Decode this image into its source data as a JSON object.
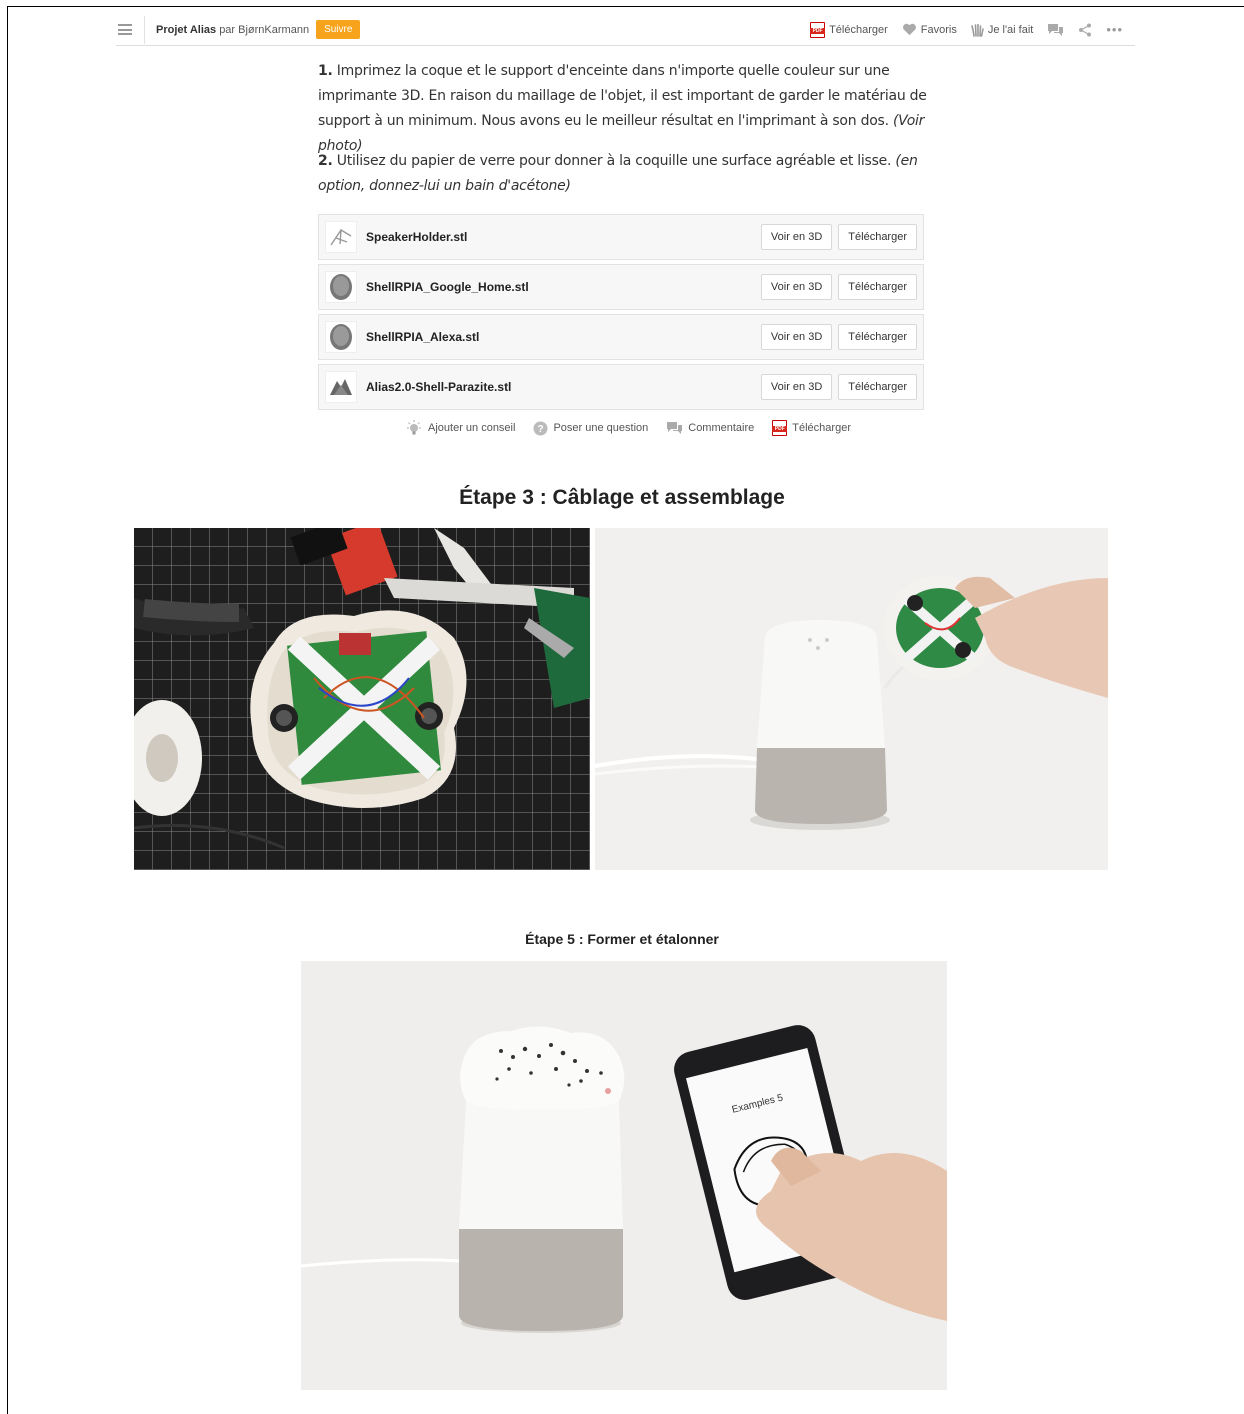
{
  "header": {
    "project_label": "Projet Alias",
    "by_label": "par BjørnKarmann",
    "follow_label": "Suivre",
    "actions": {
      "download": "Télécharger",
      "favorites": "Favoris",
      "made_it": "Je l'ai fait"
    }
  },
  "step2": {
    "p1_num": "1.",
    "p1_text": " Imprimez la coque et le support d'enceinte dans n'importe quelle couleur sur une imprimante 3D. En raison du maillage de l'objet, il est important de garder le matériau de support à un minimum. Nous avons eu le meilleur résultat en l'imprimant à son dos. ",
    "p1_italic": "(Voir photo)",
    "p2_num": "2.",
    "p2_text": " Utilisez du papier de verre pour donner à la coquille une surface agréable et lisse. ",
    "p2_italic": "(en option, donnez-lui un bain d'acétone)",
    "files": [
      {
        "name": "SpeakerHolder.stl",
        "view": "Voir en 3D",
        "download": "Télécharger"
      },
      {
        "name": "ShellRPIA_Google_Home.stl",
        "view": "Voir en 3D",
        "download": "Télécharger"
      },
      {
        "name": "ShellRPIA_Alexa.stl",
        "view": "Voir en 3D",
        "download": "Télécharger"
      },
      {
        "name": "Alias2.0-Shell-Parazite.stl",
        "view": "Voir en 3D",
        "download": "Télécharger"
      }
    ],
    "actions": {
      "tip": "Ajouter un conseil",
      "question": "Poser une question",
      "comment": "Commentaire",
      "download": "Télécharger"
    }
  },
  "step3": {
    "title": "Étape 3 : Câblage et assemblage"
  },
  "step5": {
    "title": "Étape 5 : Former et étalonner"
  },
  "colors": {
    "accent": "#f7a31c",
    "pdf_red": "#d8261c"
  }
}
